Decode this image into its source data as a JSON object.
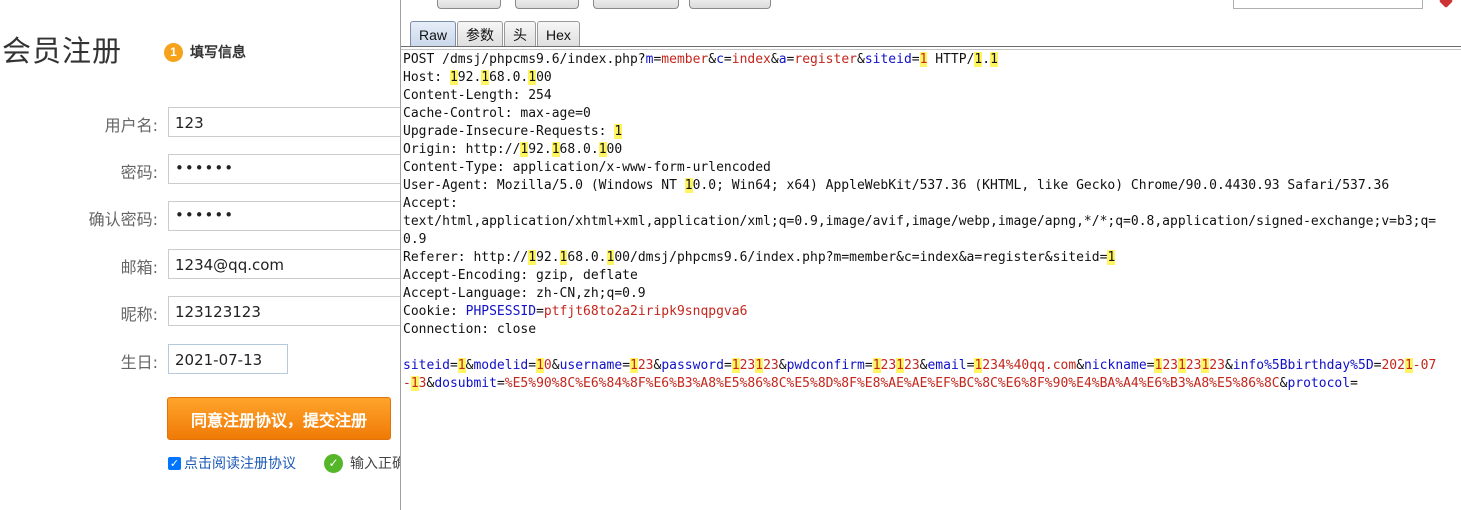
{
  "form": {
    "title": "会员注册",
    "step_number": "1",
    "step_label": "填写信息",
    "fields": [
      {
        "label": "用户名:",
        "value": "123"
      },
      {
        "label": "密码:",
        "value": "••••••"
      },
      {
        "label": "确认密码:",
        "value": "••••••"
      },
      {
        "label": "邮箱:",
        "value": "1234@qq.com"
      },
      {
        "label": "昵称:",
        "value": "123123123"
      },
      {
        "label": "生日:",
        "value": "2021-07-13"
      }
    ],
    "submit_label": "同意注册协议，提交注册",
    "agree_label": "点击阅读注册协议",
    "hint_text": "输入正确"
  },
  "viewer": {
    "tabs": [
      "Raw",
      "参数",
      "头",
      "Hex"
    ],
    "active_tab": "Raw",
    "colors": {
      "highlight": "#fff562",
      "param_key": "#1010c8",
      "param_value": "#c4261c"
    },
    "request_lines": [
      [
        [
          "POST /dmsj/phpcms9.6/index.php?",
          ""
        ],
        [
          "m",
          "k"
        ],
        [
          "=",
          ""
        ],
        [
          "member",
          "v"
        ],
        [
          "&",
          ""
        ],
        [
          "c",
          "k"
        ],
        [
          "=",
          ""
        ],
        [
          "index",
          "v"
        ],
        [
          "&",
          ""
        ],
        [
          "a",
          "k"
        ],
        [
          "=",
          ""
        ],
        [
          "register",
          "v"
        ],
        [
          "&",
          ""
        ],
        [
          "siteid",
          "k"
        ],
        [
          "=",
          ""
        ],
        [
          "1",
          "vh"
        ],
        [
          " HTTP/",
          ""
        ],
        [
          "1",
          "h"
        ],
        [
          ".",
          ""
        ],
        [
          "1",
          "h"
        ]
      ],
      [
        [
          "Host: ",
          ""
        ],
        [
          "1",
          "h"
        ],
        [
          "92.",
          ""
        ],
        [
          "1",
          "h"
        ],
        [
          "68.0.",
          ""
        ],
        [
          "1",
          "h"
        ],
        [
          "00",
          ""
        ]
      ],
      [
        [
          "Content-Length: 254",
          ""
        ]
      ],
      [
        [
          "Cache-Control: max-age=0",
          ""
        ]
      ],
      [
        [
          "Upgrade-Insecure-Requests: ",
          ""
        ],
        [
          "1",
          "h"
        ]
      ],
      [
        [
          "Origin: http://",
          ""
        ],
        [
          "1",
          "h"
        ],
        [
          "92.",
          ""
        ],
        [
          "1",
          "h"
        ],
        [
          "68.0.",
          ""
        ],
        [
          "1",
          "h"
        ],
        [
          "00",
          ""
        ]
      ],
      [
        [
          "Content-Type: application/x-www-form-urlencoded",
          ""
        ]
      ],
      [
        [
          "User-Agent: Mozilla/5.0 (Windows NT ",
          ""
        ],
        [
          "1",
          "h"
        ],
        [
          "0.0; Win64; x64) AppleWebKit/537.36 (KHTML, like Gecko) Chrome/90.0.4430.93 Safari/537.36",
          ""
        ]
      ],
      [
        [
          "Accept:",
          ""
        ]
      ],
      [
        [
          "text/html,application/xhtml+xml,application/xml;q=0.9,image/avif,image/webp,image/apng,*/*;q=0.8,application/signed-exchange;v=b3;q=",
          ""
        ]
      ],
      [
        [
          "0.9",
          ""
        ]
      ],
      [
        [
          "Referer: http://",
          ""
        ],
        [
          "1",
          "h"
        ],
        [
          "92.",
          ""
        ],
        [
          "1",
          "h"
        ],
        [
          "68.0.",
          ""
        ],
        [
          "1",
          "h"
        ],
        [
          "00/dmsj/phpcms9.6/index.php?m=member&c=index&a=register&siteid=",
          ""
        ],
        [
          "1",
          "h"
        ]
      ],
      [
        [
          "Accept-Encoding: gzip, deflate",
          ""
        ]
      ],
      [
        [
          "Accept-Language: zh-CN,zh;q=0.9",
          ""
        ]
      ],
      [
        [
          "Cookie: ",
          ""
        ],
        [
          "PHPSESSID",
          "k"
        ],
        [
          "=",
          ""
        ],
        [
          "ptfjt68to2a2iripk9snqpgva6",
          "v"
        ]
      ],
      [
        [
          "Connection: close",
          ""
        ]
      ],
      [
        [
          "",
          ""
        ]
      ],
      [
        [
          "siteid",
          "k"
        ],
        [
          "=",
          ""
        ],
        [
          "1",
          "vh"
        ],
        [
          "&",
          ""
        ],
        [
          "modelid",
          "k"
        ],
        [
          "=",
          ""
        ],
        [
          "1",
          "vh"
        ],
        [
          "0",
          "v"
        ],
        [
          "&",
          ""
        ],
        [
          "username",
          "k"
        ],
        [
          "=",
          ""
        ],
        [
          "1",
          "vh"
        ],
        [
          "23",
          "v"
        ],
        [
          "&",
          ""
        ],
        [
          "password",
          "k"
        ],
        [
          "=",
          ""
        ],
        [
          "1",
          "vh"
        ],
        [
          "23",
          "v"
        ],
        [
          "1",
          "vh"
        ],
        [
          "23",
          "v"
        ],
        [
          "&",
          ""
        ],
        [
          "pwdconfirm",
          "k"
        ],
        [
          "=",
          ""
        ],
        [
          "1",
          "vh"
        ],
        [
          "23",
          "v"
        ],
        [
          "1",
          "vh"
        ],
        [
          "23",
          "v"
        ],
        [
          "&",
          ""
        ],
        [
          "email",
          "k"
        ],
        [
          "=",
          ""
        ],
        [
          "1",
          "vh"
        ],
        [
          "234%40qq.com",
          "v"
        ],
        [
          "&",
          ""
        ],
        [
          "nickname",
          "k"
        ],
        [
          "=",
          ""
        ],
        [
          "1",
          "vh"
        ],
        [
          "23",
          "v"
        ],
        [
          "1",
          "vh"
        ],
        [
          "23",
          "v"
        ],
        [
          "1",
          "vh"
        ],
        [
          "23",
          "v"
        ],
        [
          "&",
          ""
        ],
        [
          "info%5Bbirthday%5D",
          "k"
        ],
        [
          "=",
          ""
        ],
        [
          "202",
          "v"
        ],
        [
          "1",
          "vh"
        ],
        [
          "-07",
          "v"
        ]
      ],
      [
        [
          "-",
          "v"
        ],
        [
          "1",
          "vh"
        ],
        [
          "3",
          "v"
        ],
        [
          "&",
          ""
        ],
        [
          "dosubmit",
          "k"
        ],
        [
          "=",
          ""
        ],
        [
          "%E5%90%8C%E6%84%8F%E6%B3%A8%E5%86%8C%E5%8D%8F%E8%AE%AE%EF%BC%8C%E6%8F%90%E4%BA%A4%E6%B3%A8%E5%86%8C",
          "v"
        ],
        [
          "&",
          ""
        ],
        [
          "protocol",
          "k"
        ],
        [
          "=",
          ""
        ]
      ]
    ]
  }
}
